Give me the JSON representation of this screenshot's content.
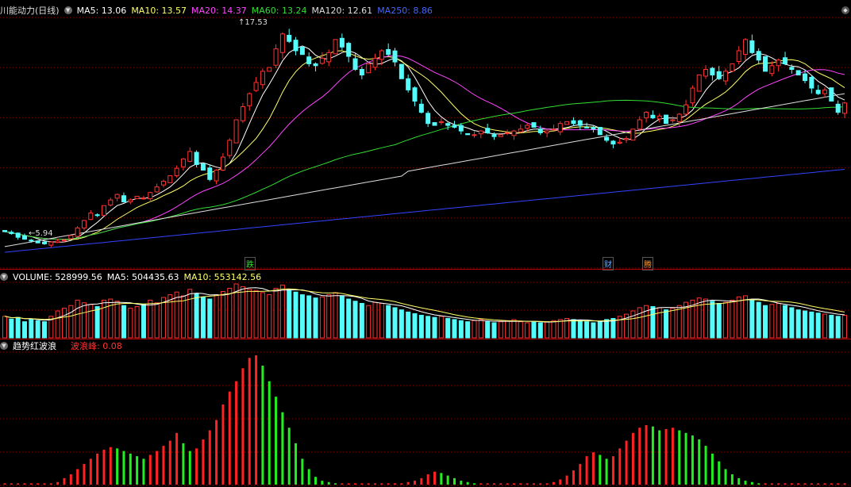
{
  "main_panel": {
    "title": "川能动力(日线)",
    "ma_labels": [
      {
        "text": "MA5: 13.06",
        "color": "#ffffff"
      },
      {
        "text": "MA10: 13.57",
        "color": "#ffff66"
      },
      {
        "text": "MA20: 14.37",
        "color": "#ff44ff"
      },
      {
        "text": "MA60: 13.24",
        "color": "#33dd33"
      },
      {
        "text": "MA120: 12.61",
        "color": "#dddddd"
      },
      {
        "text": "MA250: 8.86",
        "color": "#4466ff"
      }
    ],
    "high_label": "17.53",
    "low_label": "5.94",
    "event_marks": [
      {
        "text": "跌",
        "color": "#33dd33"
      },
      {
        "text": "财",
        "color": "#66aaff"
      },
      {
        "text": "腾",
        "color": "#ff9933"
      }
    ]
  },
  "volume_panel": {
    "labels": [
      {
        "text": "VOLUME: 528999.56",
        "color": "#ffffff"
      },
      {
        "text": "MA5: 504435.63",
        "color": "#ffffff"
      },
      {
        "text": "MA10: 553142.56",
        "color": "#ffff66"
      }
    ]
  },
  "indicator_panel": {
    "title": "趋势红波浪",
    "value_label": "波浪峰: 0.08",
    "value_color": "#ff3333"
  },
  "colors": {
    "up": "#ff3333",
    "down": "#54fcfc",
    "ma5": "#ffffff",
    "ma10": "#ffff66",
    "ma20": "#ff44ff",
    "ma60": "#33dd33",
    "ma120": "#dddddd",
    "ma250": "#3344ff",
    "grid": "#8b0000",
    "wave_red": "#ff2222",
    "wave_green": "#22ee22"
  },
  "chart_data": [
    {
      "type": "candlestick",
      "title": "川能动力(日线)",
      "y_range_estimate": [
        5.5,
        18.0
      ],
      "close": [
        6.6,
        6.5,
        6.3,
        6.2,
        6.1,
        6.0,
        5.95,
        6.05,
        6.1,
        6.15,
        6.4,
        6.8,
        7.2,
        7.6,
        7.5,
        8.0,
        8.3,
        8.6,
        8.2,
        8.3,
        8.5,
        8.4,
        8.7,
        9.0,
        9.3,
        9.6,
        10.0,
        10.5,
        10.9,
        10.2,
        9.9,
        9.4,
        9.9,
        10.6,
        11.5,
        12.6,
        13.3,
        14.0,
        14.6,
        15.2,
        15.4,
        16.4,
        17.2,
        16.8,
        16.3,
        16.1,
        15.6,
        15.5,
        15.9,
        16.2,
        16.9,
        16.5,
        16.0,
        15.3,
        15.0,
        15.6,
        15.9,
        16.3,
        16.1,
        15.7,
        14.8,
        14.2,
        13.6,
        13.0,
        12.4,
        12.3,
        12.5,
        12.3,
        12.2,
        12.0,
        11.8,
        11.8,
        12.0,
        11.9,
        11.7,
        11.8,
        11.9,
        12.0,
        12.1,
        12.3,
        12.2,
        11.9,
        12.0,
        12.1,
        12.4,
        12.5,
        12.4,
        12.3,
        12.2,
        12.1,
        11.8,
        11.5,
        11.3,
        11.4,
        11.6,
        12.1,
        12.6,
        13.0,
        12.7,
        12.8,
        12.4,
        12.6,
        12.9,
        13.4,
        14.3,
        15.0,
        15.3,
        15.0,
        14.8,
        15.2,
        15.6,
        16.3,
        16.9,
        16.2,
        15.8,
        15.2,
        15.5,
        15.8,
        15.6,
        15.3,
        15.0,
        14.7,
        14.3,
        14.0,
        14.2,
        13.6,
        13.0,
        13.5
      ]
    },
    {
      "type": "bar",
      "title": "VOLUME",
      "values_relative": [
        0.4,
        0.35,
        0.38,
        0.3,
        0.35,
        0.32,
        0.3,
        0.4,
        0.5,
        0.55,
        0.6,
        0.7,
        0.65,
        0.62,
        0.58,
        0.7,
        0.72,
        0.68,
        0.6,
        0.55,
        0.58,
        0.62,
        0.7,
        0.65,
        0.75,
        0.8,
        0.85,
        0.78,
        0.9,
        0.82,
        0.76,
        0.72,
        0.8,
        0.86,
        0.92,
        1.0,
        0.95,
        0.9,
        0.88,
        0.84,
        0.8,
        0.92,
        0.98,
        0.9,
        0.85,
        0.8,
        0.78,
        0.74,
        0.76,
        0.8,
        0.84,
        0.78,
        0.72,
        0.68,
        0.64,
        0.6,
        0.66,
        0.64,
        0.6,
        0.56,
        0.52,
        0.48,
        0.45,
        0.42,
        0.4,
        0.38,
        0.4,
        0.36,
        0.34,
        0.32,
        0.3,
        0.32,
        0.34,
        0.3,
        0.28,
        0.3,
        0.32,
        0.34,
        0.3,
        0.28,
        0.3,
        0.28,
        0.3,
        0.32,
        0.34,
        0.36,
        0.34,
        0.32,
        0.3,
        0.28,
        0.3,
        0.34,
        0.36,
        0.4,
        0.44,
        0.5,
        0.56,
        0.6,
        0.58,
        0.56,
        0.52,
        0.55,
        0.6,
        0.66,
        0.7,
        0.74,
        0.72,
        0.68,
        0.64,
        0.66,
        0.7,
        0.76,
        0.78,
        0.7,
        0.66,
        0.6,
        0.62,
        0.64,
        0.6,
        0.56,
        0.52,
        0.5,
        0.48,
        0.46,
        0.44,
        0.42,
        0.4,
        0.42
      ]
    },
    {
      "type": "bar",
      "title": "趋势红波浪",
      "values_relative": [
        0.01,
        0.01,
        0.01,
        0.01,
        0.01,
        0.01,
        0.01,
        0.01,
        0.02,
        0.05,
        0.08,
        0.12,
        0.16,
        0.2,
        0.24,
        0.27,
        0.29,
        0.28,
        0.26,
        0.24,
        0.22,
        0.2,
        0.23,
        0.26,
        0.3,
        0.34,
        0.4,
        0.32,
        0.26,
        0.28,
        0.35,
        0.42,
        0.5,
        0.62,
        0.72,
        0.8,
        0.9,
        0.98,
        1.0,
        0.92,
        0.8,
        0.68,
        0.56,
        0.44,
        0.32,
        0.2,
        0.12,
        0.06,
        0.03,
        0.02,
        0.01,
        0.01,
        0.01,
        0.01,
        0.01,
        0.01,
        0.01,
        0.01,
        0.01,
        0.01,
        0.01,
        0.02,
        0.03,
        0.05,
        0.08,
        0.1,
        0.09,
        0.07,
        0.05,
        0.03,
        0.02,
        0.01,
        0.01,
        0.01,
        0.01,
        0.01,
        0.01,
        0.01,
        0.01,
        0.01,
        0.01,
        0.01,
        0.01,
        0.02,
        0.04,
        0.07,
        0.11,
        0.16,
        0.22,
        0.25,
        0.23,
        0.2,
        0.22,
        0.28,
        0.34,
        0.4,
        0.44,
        0.46,
        0.45,
        0.42,
        0.43,
        0.44,
        0.42,
        0.4,
        0.38,
        0.35,
        0.3,
        0.24,
        0.18,
        0.12,
        0.08,
        0.05,
        0.03,
        0.02,
        0.01,
        0.01,
        0.01,
        0.01,
        0.01,
        0.01,
        0.01,
        0.01,
        0.01,
        0.01,
        0.01,
        0.01,
        0.01,
        0.01
      ],
      "color_switch": "red while rising, green while falling"
    }
  ]
}
